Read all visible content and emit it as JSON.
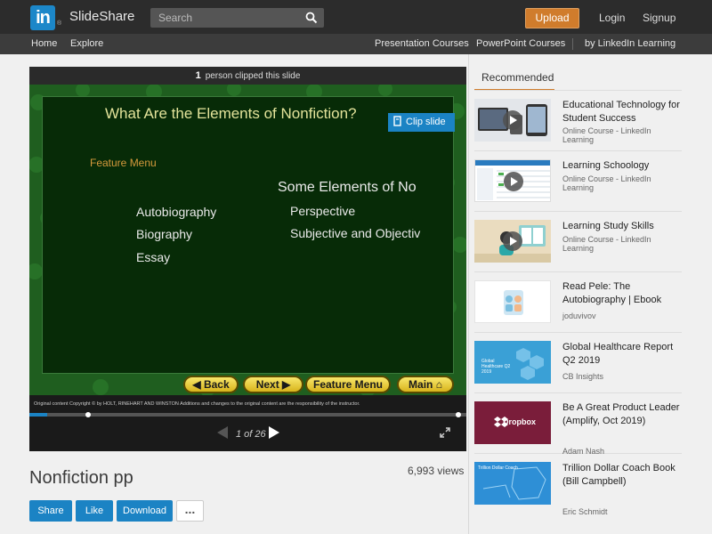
{
  "header": {
    "logo_mark": "in",
    "logo_registered": "®",
    "brand": "SlideShare",
    "search_placeholder": "Search",
    "upload": "Upload",
    "login": "Login",
    "signup": "Signup"
  },
  "nav": {
    "home": "Home",
    "explore": "Explore",
    "presentation_courses": "Presentation Courses",
    "powerpoint_courses": "PowerPoint Courses",
    "linkedin_learning": "by LinkedIn Learning"
  },
  "player": {
    "clip_count": "1",
    "clip_text": "person clipped this slide",
    "clip_slide_label": "Clip slide",
    "current_page": "1",
    "page_counter": "1 of 26",
    "progress": 0.04,
    "slide": {
      "title": "What Are the Elements of Nonfiction?",
      "feature_menu": "Feature Menu",
      "right_heading": "Some Elements of No",
      "left_items": [
        "Autobiography",
        "Biography",
        "Essay"
      ],
      "right_items": [
        "Perspective",
        "Subjective and Objectiv"
      ],
      "buttons": {
        "back": "Back",
        "next": "Next",
        "feature_menu": "Feature Menu",
        "main": "Main"
      },
      "copyright": "Original content Copyright © by HOLT, RINEHART AND WINSTON  Additions and changes to the original content are the responsibility of the instructor."
    }
  },
  "document": {
    "title": "Nonfiction pp",
    "views": "6,993 views",
    "share": "Share",
    "like": "Like",
    "download": "Download",
    "more": "..."
  },
  "sidebar": {
    "tab": "Recommended",
    "items": [
      {
        "title": "Educational Technology for Student Success",
        "subtitle": "Online Course - LinkedIn Learning"
      },
      {
        "title": "Learning Schoology",
        "subtitle": "Online Course - LinkedIn Learning"
      },
      {
        "title": "Learning Study Skills",
        "subtitle": "Online Course - LinkedIn Learning"
      },
      {
        "title": "Read Pele: The Autobiography | Ebook",
        "subtitle": "joduvivov"
      },
      {
        "title": "Global Healthcare Report Q2 2019",
        "subtitle": "CB Insights"
      },
      {
        "title": "Be A Great Product Leader (Amplify, Oct 2019)",
        "subtitle": "Adam Nash"
      },
      {
        "title": "Trillion Dollar Coach Book (Bill Campbell)",
        "subtitle": "Eric Schmidt"
      }
    ],
    "thumb_texts": {
      "dropbox": "Dropbox",
      "healthcare": "Global Healthcare Q2 2019",
      "coach": "Trillion Dollar Coach"
    }
  },
  "colors": {
    "accent_blue": "#1b83c4",
    "upload_orange": "#d07c2c",
    "topbar": "#2c2c2c",
    "slide_green": "#072b07"
  }
}
